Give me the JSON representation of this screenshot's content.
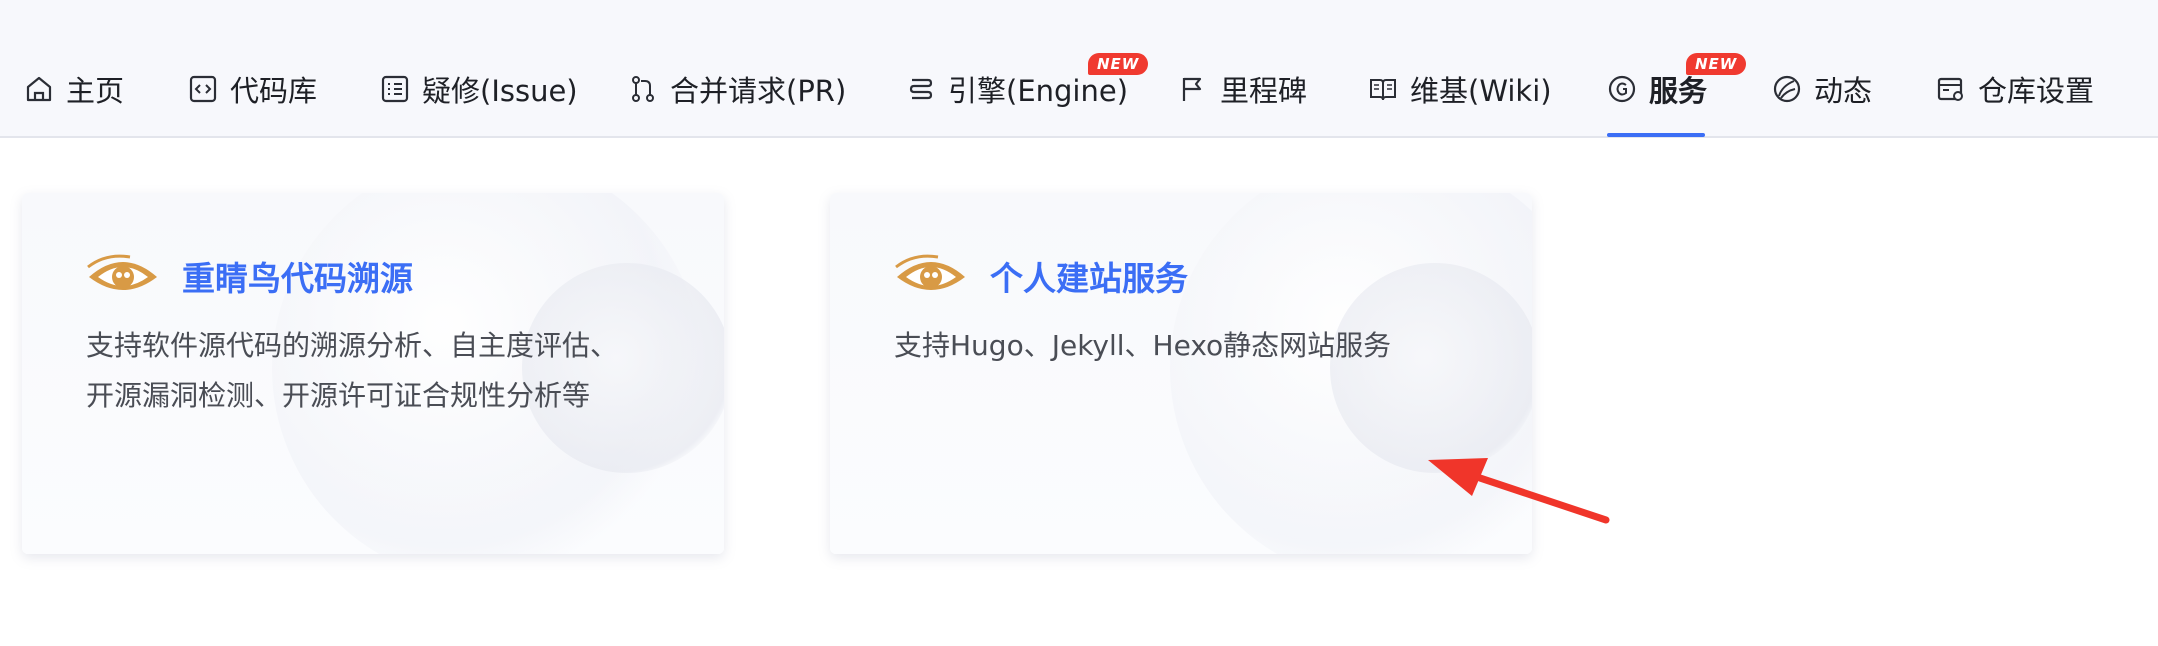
{
  "nav": {
    "tabs": [
      {
        "label": "主页",
        "icon": "home-icon"
      },
      {
        "label": "代码库",
        "icon": "code-icon"
      },
      {
        "label": "疑修(Issue)",
        "icon": "issue-list-icon"
      },
      {
        "label": "合并请求(PR)",
        "icon": "merge-request-icon"
      },
      {
        "label": "引擎(Engine)",
        "icon": "engine-icon",
        "badge": "NEW"
      },
      {
        "label": "里程碑",
        "icon": "milestone-flag-icon"
      },
      {
        "label": "维基(Wiki)",
        "icon": "wiki-book-icon"
      },
      {
        "label": "服务",
        "icon": "service-icon",
        "badge": "NEW",
        "active": true
      },
      {
        "label": "动态",
        "icon": "activity-icon"
      },
      {
        "label": "仓库设置",
        "icon": "settings-icon"
      }
    ]
  },
  "cards": [
    {
      "title": "重睛鸟代码溯源",
      "description_lines": [
        "支持软件源代码的溯源分析、自主度评估、",
        "开源漏洞检测、开源许可证合规性分析等"
      ],
      "logo": "eye-bird-logo"
    },
    {
      "title": "个人建站服务",
      "description_lines": [
        "支持Hugo、Jekyll、Hexo静态网站服务"
      ],
      "logo": "eye-bird-logo"
    }
  ],
  "colors": {
    "accent": "#3b6ef5",
    "badge": "#f03a30",
    "arrow": "#f0352a",
    "logo_gold": "#d89a45"
  }
}
